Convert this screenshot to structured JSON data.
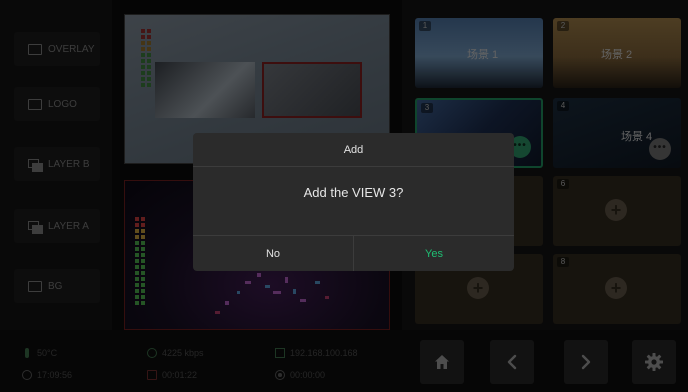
{
  "sources": [
    {
      "label": "OVERLAY",
      "icon": "overlay-icon"
    },
    {
      "label": "LOGO",
      "icon": "logo-icon"
    },
    {
      "label": "LAYER B",
      "icon": "layers-icon"
    },
    {
      "label": "LAYER A",
      "icon": "layers-icon"
    },
    {
      "label": "BG",
      "icon": "image-icon"
    }
  ],
  "scenes": [
    {
      "num": "1",
      "name": "场景 1"
    },
    {
      "num": "2",
      "name": "场景 2"
    },
    {
      "num": "3",
      "name": ""
    },
    {
      "num": "4",
      "name": "场景 4"
    },
    {
      "num": "",
      "name": ""
    },
    {
      "num": "6",
      "name": ""
    },
    {
      "num": "",
      "name": ""
    },
    {
      "num": "8",
      "name": ""
    }
  ],
  "status": {
    "temperature": "50°C",
    "bitrate": "4225 kbps",
    "ip": "192.168.100.168",
    "clock": "17:09:56",
    "record_time": "00:01:22",
    "stream_time": "00:00:00"
  },
  "dialog": {
    "title": "Add",
    "message": "Add the VIEW 3?",
    "no_label": "No",
    "yes_label": "Yes"
  },
  "colors": {
    "accent_green": "#1fbf73",
    "active_border": "#1f8a5a",
    "program_border": "#6b1d1d"
  }
}
